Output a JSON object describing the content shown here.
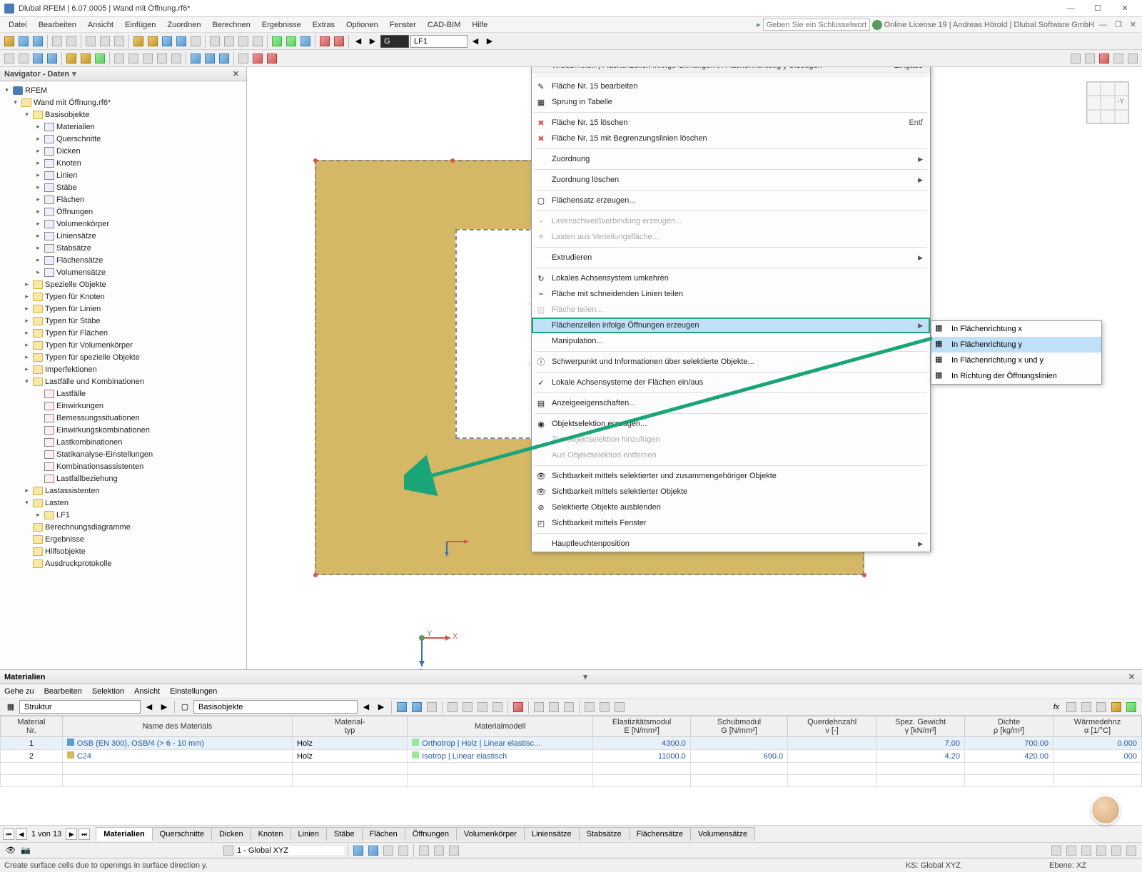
{
  "title": "Dlubal RFEM | 6.07.0005 | Wand mit Öffnung.rf6*",
  "menubar": [
    "Datei",
    "Bearbeiten",
    "Ansicht",
    "Einfügen",
    "Zuordnen",
    "Berechnen",
    "Ergebnisse",
    "Extras",
    "Optionen",
    "Fenster",
    "CAD-BIM",
    "Hilfe"
  ],
  "keyword_placeholder": "Geben Sie ein Schlüsselwort ein (Alt...",
  "license_info": "Online License 19 | Andreas Hörold | Dlubal Software GmbH",
  "toolbar2_combo": "LF1",
  "navigator": {
    "title": "Navigator - Daten",
    "root": "RFEM",
    "file": "Wand mit Öffnung.rf6*",
    "basisobjekte": "Basisobjekte",
    "basis_items": [
      "Materialien",
      "Querschnitte",
      "Dicken",
      "Knoten",
      "Linien",
      "Stäbe",
      "Flächen",
      "Öffnungen",
      "Volumenkörper",
      "Liniensätze",
      "Stabsätze",
      "Flächensätze",
      "Volumensätze"
    ],
    "mid_items": [
      "Spezielle Objekte",
      "Typen für Knoten",
      "Typen für Linien",
      "Typen für Stäbe",
      "Typen für Flächen",
      "Typen für Volumenkörper",
      "Typen für spezielle Objekte",
      "Imperfektionen"
    ],
    "lastfaelle": "Lastfälle und Kombinationen",
    "lf_items": [
      "Lastfälle",
      "Einwirkungen",
      "Bemessungssituationen",
      "Einwirkungskombinationen",
      "Lastkombinationen",
      "Statikanalyse-Einstellungen",
      "Kombinationsassistenten",
      "Lastfallbeziehung"
    ],
    "lastassistenten": "Lastassistenten",
    "lasten": "Lasten",
    "lf1": "LF1",
    "end_items": [
      "Berechnungsdiagramme",
      "Ergebnisse",
      "Hilfsobjekte",
      "Ausdruckprotokolle"
    ]
  },
  "orient_label": "-Y",
  "axes": {
    "x": "X",
    "y": "Y",
    "z": "Z"
  },
  "ctx": {
    "header": "Wiederholen | Flächenzellen infolge Öffnungen in Flächenrichtung y erzeugen",
    "header_short": "Eingabe",
    "edit": "Fläche Nr. 15 bearbeiten",
    "jump": "Sprung in Tabelle",
    "delete": "Fläche Nr. 15 löschen",
    "delete_short": "Entf",
    "delete_bound": "Fläche Nr. 15 mit Begrenzungslinien löschen",
    "zuordnung": "Zuordnung",
    "zuord_loeschen": "Zuordnung löschen",
    "flsatz": "Flächensatz erzeugen...",
    "lsv": "Linienschweißverbindung erzeugen...",
    "lav": "Lasten aus Verteilungsfläche...",
    "extrud": "Extrudieren",
    "las_umk": "Lokales Achsensystem umkehren",
    "schn": "Fläche mit schneidenden Linien teilen",
    "teilen": "Fläche teilen...",
    "cells": "Flächenzellen infolge Öffnungen erzeugen",
    "manip": "Manipulation...",
    "schwerpunkt": "Schwerpunkt und Informationen über selektierte Objekte...",
    "las_ea": "Lokale Achsensysteme der Flächen ein/aus",
    "anzeige": "Anzeigeeigenschaften...",
    "objsel": "Objektselektion erzeugen...",
    "zur_objsel": "Zur Objektselektion hinzufügen",
    "aus_objsel": "Aus Objektselektion entfernen",
    "sicht_sel_zus": "Sichtbarkeit mittels selektierter und zusammengehöriger Objekte",
    "sicht_sel": "Sichtbarkeit mittels selektierter Objekte",
    "sel_ausbl": "Selektierte Objekte ausblenden",
    "sicht_fenster": "Sichtbarkeit mittels Fenster",
    "haupt": "Hauptleuchtenposition"
  },
  "submenu": {
    "x": "In Flächenrichtung x",
    "y": "In Flächenrichtung y",
    "xy": "In Flächenrichtung x und y",
    "oeff": "In Richtung der Öffnungslinien"
  },
  "bottom": {
    "title": "Materialien",
    "menus": [
      "Gehe zu",
      "Bearbeiten",
      "Selektion",
      "Ansicht",
      "Einstellungen"
    ],
    "combo1": "Struktur",
    "combo2": "Basisobjekte",
    "headers": {
      "nr": "Material\nNr.",
      "name": "Name des Materials",
      "typ": "Material-\ntyp",
      "modell": "Materialmodell",
      "emod": "Elastizitätsmodul\nE [N/mm²]",
      "gmod": "Schubmodul\nG [N/mm²]",
      "quer": "Querdehnzahl\nν [-]",
      "spez": "Spez. Gewicht\nγ [kN/m³]",
      "dichte": "Dichte\nρ [kg/m³]",
      "waerme": "Wärmedehnz\nα [1/°C]"
    },
    "rows": [
      {
        "nr": "1",
        "name": "OSB (EN 300), OSB/4 (> 6 - 10 mm)",
        "typ": "Holz",
        "modell": "Orthotrop | Holz | Linear elastisc...",
        "e": "4300.0",
        "g": "",
        "v": "",
        "spez": "7.00",
        "dichte": "700.00",
        "a": "0.000"
      },
      {
        "nr": "2",
        "name": "C24",
        "typ": "Holz",
        "modell": "Isotrop | Linear elastisch",
        "e": "11000.0",
        "g": "690.0",
        "v": "",
        "spez": "4.20",
        "dichte": "420.00",
        "a": ".000"
      }
    ],
    "page": "1 von 13",
    "tabs": [
      "Materialien",
      "Querschnitte",
      "Dicken",
      "Knoten",
      "Linien",
      "Stäbe",
      "Flächen",
      "Öffnungen",
      "Volumenkörper",
      "Liniensätze",
      "Stabsätze",
      "Flächensätze",
      "Volumensätze"
    ]
  },
  "sb_toolbar_combo": "1 - Global XYZ",
  "status": {
    "hint": "Create surface cells due to openings in surface direction y.",
    "ks": "KS: Global XYZ",
    "ebene": "Ebene: XZ"
  }
}
